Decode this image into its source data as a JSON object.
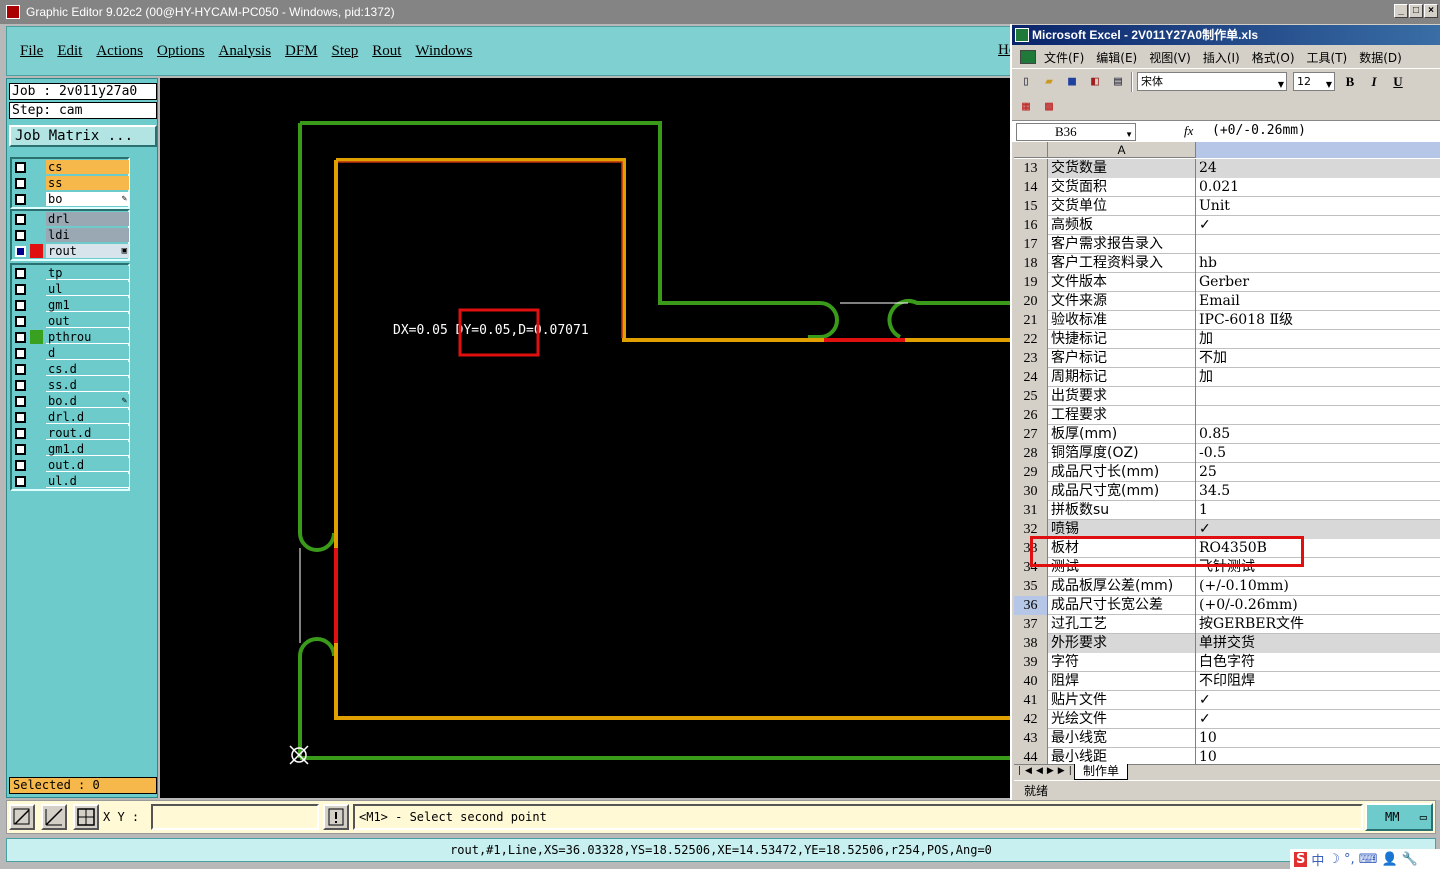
{
  "ge": {
    "title": "Graphic Editor 9.02c2 (00@HY-HYCAM-PC050 - Windows, pid:1372)",
    "menu": [
      "File",
      "Edit",
      "Actions",
      "Options",
      "Analysis",
      "DFM",
      "Step",
      "Rout",
      "Windows"
    ],
    "help_label": "Hel",
    "job": "Job : 2v011y27a0",
    "step": "Step: cam",
    "job_matrix": "Job Matrix ...",
    "layer_groups": [
      [
        {
          "name": "cs",
          "style": "orange",
          "color": "",
          "check": "white"
        },
        {
          "name": "ss",
          "style": "orange",
          "color": "",
          "check": "white"
        },
        {
          "name": "bo",
          "style": "white",
          "color": "",
          "check": "white",
          "mark": "✎"
        }
      ],
      [
        {
          "name": "drl",
          "style": "grey",
          "color": "",
          "check": "white"
        },
        {
          "name": "ldi",
          "style": "grey",
          "color": "",
          "check": "white"
        },
        {
          "name": "rout",
          "style": "light",
          "color": "#e01010",
          "check": "blue",
          "mark": "▣"
        }
      ],
      [
        {
          "name": "tp",
          "style": "teal",
          "color": "",
          "check": "white"
        },
        {
          "name": "ul",
          "style": "teal",
          "color": "",
          "check": "white"
        },
        {
          "name": "gm1",
          "style": "teal",
          "color": "",
          "check": "white"
        },
        {
          "name": "out",
          "style": "teal",
          "color": "",
          "check": "white"
        },
        {
          "name": "pthrou",
          "style": "teal",
          "color": "#3aa020",
          "check": "white"
        },
        {
          "name": "d",
          "style": "teal",
          "color": "",
          "check": "white"
        },
        {
          "name": "cs.d",
          "style": "teal",
          "color": "",
          "check": "white"
        },
        {
          "name": "ss.d",
          "style": "teal",
          "color": "",
          "check": "white"
        },
        {
          "name": "bo.d",
          "style": "teal",
          "color": "",
          "check": "white",
          "mark": "✎"
        },
        {
          "name": "drl.d",
          "style": "teal",
          "color": "",
          "check": "white"
        },
        {
          "name": "rout.d",
          "style": "teal",
          "color": "",
          "check": "white"
        },
        {
          "name": "gm1.d",
          "style": "teal",
          "color": "",
          "check": "white"
        },
        {
          "name": "out.d",
          "style": "teal",
          "color": "",
          "check": "white"
        },
        {
          "name": "ul.d",
          "style": "teal",
          "color": "",
          "check": "white"
        }
      ]
    ],
    "selected": "Selected : 0",
    "measure_text": "DX=0.05 DY=0.05,D=0.07071",
    "xy_label": "X Y :",
    "xy_value": "",
    "prompt": "<M1> - Select second point",
    "units": "MM",
    "status": "rout,#1,Line,XS=36.03328,YS=18.52506,XE=14.53472,YE=18.52506,r254,POS,Ang=0",
    "colors": {
      "outline": "#3a9a1a",
      "inner": "#e0a000",
      "rout": "#e01010",
      "highlight": "#e01010"
    }
  },
  "xl": {
    "title": "Microsoft Excel - 2V011Y27A0制作单.xls",
    "menu": [
      "文件(F)",
      "编辑(E)",
      "视图(V)",
      "插入(I)",
      "格式(O)",
      "工具(T)",
      "数据(D)"
    ],
    "font": "宋体",
    "size": "12",
    "cell_ref": "B36",
    "formula": "(+0/-0.26mm)",
    "col_a": "A",
    "rows": [
      {
        "n": "13",
        "a": "交货数量",
        "b": "24"
      },
      {
        "n": "14",
        "a": "交货面积",
        "b": "0.021"
      },
      {
        "n": "15",
        "a": "交货单位",
        "b": "Unit"
      },
      {
        "n": "16",
        "a": "高频板",
        "b": "✓"
      },
      {
        "n": "17",
        "a": "客户需求报告录入",
        "b": ""
      },
      {
        "n": "18",
        "a": "客户工程资料录入",
        "b": "hb"
      },
      {
        "n": "19",
        "a": "文件版本",
        "b": "Gerber"
      },
      {
        "n": "20",
        "a": "文件来源",
        "b": "Email"
      },
      {
        "n": "21",
        "a": "验收标准",
        "b": "IPC-6018 Ⅱ级"
      },
      {
        "n": "22",
        "a": "快捷标记",
        "b": "加"
      },
      {
        "n": "23",
        "a": "客户标记",
        "b": "不加"
      },
      {
        "n": "24",
        "a": "周期标记",
        "b": "加"
      },
      {
        "n": "25",
        "a": "出货要求",
        "b": ""
      },
      {
        "n": "26",
        "a": "工程要求",
        "b": ""
      },
      {
        "n": "27",
        "a": "板厚(mm)",
        "b": "0.85"
      },
      {
        "n": "28",
        "a": "铜箔厚度(OZ)",
        "b": "-0.5"
      },
      {
        "n": "29",
        "a": "成品尺寸长(mm)",
        "b": "25"
      },
      {
        "n": "30",
        "a": "成品尺寸宽(mm)",
        "b": "34.5"
      },
      {
        "n": "31",
        "a": "拼板数su",
        "b": "1"
      },
      {
        "n": "32",
        "a": "喷锡",
        "b": "✓"
      },
      {
        "n": "33",
        "a": "板材",
        "b": "RO4350B"
      },
      {
        "n": "34",
        "a": "测试",
        "b": "飞针测试"
      },
      {
        "n": "35",
        "a": "成品板厚公差(mm)",
        "b": "(+/-0.10mm)"
      },
      {
        "n": "36",
        "a": "成品尺寸长宽公差",
        "b": "(+0/-0.26mm)"
      },
      {
        "n": "37",
        "a": "过孔工艺",
        "b": "按GERBER文件"
      },
      {
        "n": "38",
        "a": "外形要求",
        "b": "单拼交货"
      },
      {
        "n": "39",
        "a": "字符",
        "b": "白色字符"
      },
      {
        "n": "40",
        "a": "阻焊",
        "b": "不印阻焊"
      },
      {
        "n": "41",
        "a": "贴片文件",
        "b": "✓"
      },
      {
        "n": "42",
        "a": "光绘文件",
        "b": "✓"
      },
      {
        "n": "43",
        "a": "最小线宽",
        "b": "10"
      },
      {
        "n": "44",
        "a": "最小线距",
        "b": "10"
      }
    ],
    "sheet_tab": "制作单",
    "status": "就绪"
  },
  "tray": [
    "中",
    "☽",
    "°,",
    "⌨",
    "👤",
    "🔧"
  ]
}
